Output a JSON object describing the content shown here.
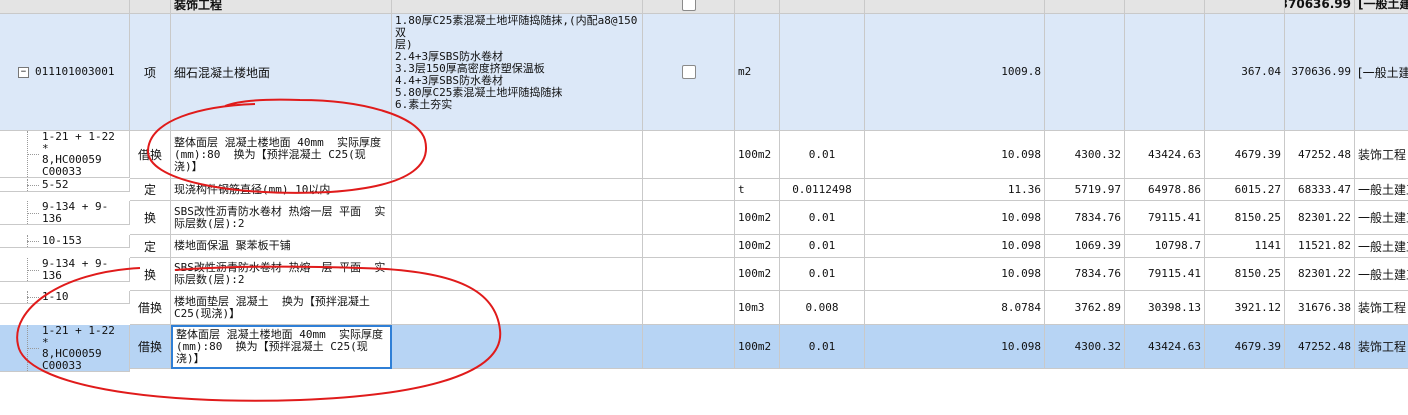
{
  "colors": {
    "header_bg": "#e4e4e4",
    "parent_bg": "#dce8f8",
    "selected_bg": "#b7d4f4",
    "annotation": "#e01b1b"
  },
  "header": {
    "name": "装饰工程",
    "price": "370636.99",
    "category": "[一般土建"
  },
  "parent": {
    "code": "011101003001",
    "type": "项",
    "name": "细石混凝土楼地面",
    "desc": "1.80厚C25素混凝土地坪随捣随抹,(内配a8@150双\n层)\n2.4+3厚SBS防水卷材\n3.3层150厚高密度挤塑保温板\n4.4+3厚SBS防水卷材\n5.80厚C25素混凝土地坪随捣随抹\n6.素土夯实",
    "unit": "m2",
    "qty_ratio": "",
    "quantity": "1009.8",
    "unit_price": "",
    "total": "",
    "comp_price": "367.04",
    "comp_total": "370636.99",
    "category": "[一般土建"
  },
  "rows": [
    {
      "code": "1-21 + 1-22 *\n8,HC00059\nC00033",
      "type": "借换",
      "name": "整体面层 混凝土楼地面 40mm  实际厚度(mm):80  换为【预拌混凝土 C25(现浇)】",
      "unit": "100m2",
      "qty_ratio": "0.01",
      "quantity": "10.098",
      "unit_price": "4300.32",
      "total": "43424.63",
      "comp_price": "4679.39",
      "comp_total": "47252.48",
      "category": "装饰工程"
    },
    {
      "code": "5-52",
      "type": "定",
      "name": "现浇构件钢筋直径(mm) 10以内",
      "unit": "t",
      "qty_ratio": "0.0112498",
      "quantity": "11.36",
      "unit_price": "5719.97",
      "total": "64978.86",
      "comp_price": "6015.27",
      "comp_total": "68333.47",
      "category": "一般土建工"
    },
    {
      "code": "9-134 + 9-136",
      "type": "换",
      "name": "SBS改性沥青防水卷材 热熔一层 平面  实际层数(层):2",
      "unit": "100m2",
      "qty_ratio": "0.01",
      "quantity": "10.098",
      "unit_price": "7834.76",
      "total": "79115.41",
      "comp_price": "8150.25",
      "comp_total": "82301.22",
      "category": "一般土建工"
    },
    {
      "code": "10-153",
      "type": "定",
      "name": "楼地面保温 聚苯板干铺",
      "unit": "100m2",
      "qty_ratio": "0.01",
      "quantity": "10.098",
      "unit_price": "1069.39",
      "total": "10798.7",
      "comp_price": "1141",
      "comp_total": "11521.82",
      "category": "一般土建工"
    },
    {
      "code": "9-134 + 9-136",
      "type": "换",
      "name": "SBS改性沥青防水卷材 热熔一层 平面  实际层数(层):2",
      "unit": "100m2",
      "qty_ratio": "0.01",
      "quantity": "10.098",
      "unit_price": "7834.76",
      "total": "79115.41",
      "comp_price": "8150.25",
      "comp_total": "82301.22",
      "category": "一般土建工"
    },
    {
      "code": "1-10",
      "type": "借换",
      "name": "楼地面垫层 混凝土  换为【预拌混凝土 C25(现浇)】",
      "unit": "10m3",
      "qty_ratio": "0.008",
      "quantity": "8.0784",
      "unit_price": "3762.89",
      "total": "30398.13",
      "comp_price": "3921.12",
      "comp_total": "31676.38",
      "category": "装饰工程"
    },
    {
      "code": "1-21 + 1-22 *\n8,HC00059\nC00033",
      "type": "借换",
      "name": "整体面层 混凝土楼地面 40mm  实际厚度(mm):80  换为【预拌混凝土 C25(现浇)】",
      "unit": "100m2",
      "qty_ratio": "0.01",
      "quantity": "10.098",
      "unit_price": "4300.32",
      "total": "43424.63",
      "comp_price": "4679.39",
      "comp_total": "47252.48",
      "category": "装饰工程"
    }
  ]
}
